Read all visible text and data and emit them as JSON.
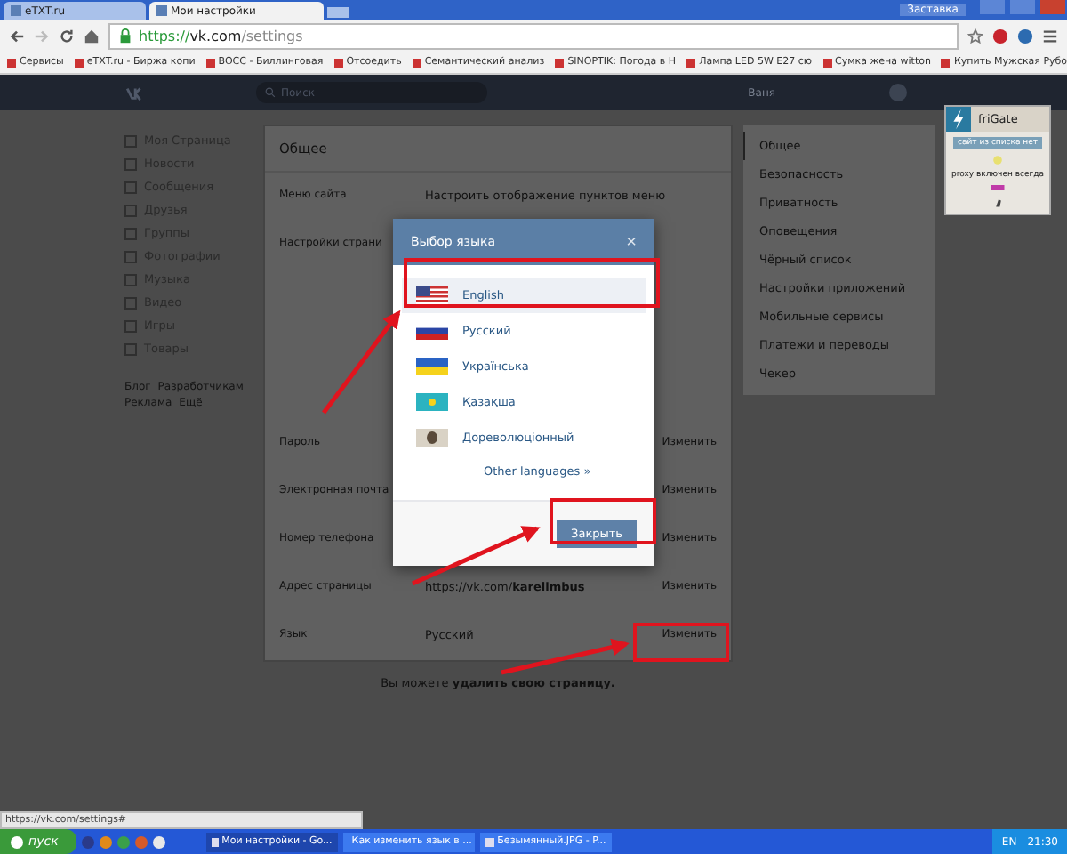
{
  "browser": {
    "tabs": [
      {
        "title": "eTXT.ru",
        "selected": false
      },
      {
        "title": "Мои настройки",
        "selected": true
      }
    ],
    "profile_button": "Заставка",
    "url": {
      "scheme": "https://",
      "host": "vk.com",
      "path": "/settings"
    },
    "bookmarks": [
      {
        "label": "Сервисы"
      },
      {
        "label": "eTXT.ru - Биржа копи"
      },
      {
        "label": "BOCC - Биллинговая"
      },
      {
        "label": "Отсоедить"
      },
      {
        "label": "Семантический анализ"
      },
      {
        "label": "SINOPTIK: Погода в Н"
      },
      {
        "label": "Лампа LED 5W E27 сю"
      },
      {
        "label": "Сумка жена witton"
      },
      {
        "label": "Купить Мужская Рубо"
      }
    ],
    "status_url": "https://vk.com/settings#"
  },
  "header": {
    "search_placeholder": "Поиск",
    "user_name": "Ваня"
  },
  "left_menu": {
    "items": [
      "Моя Страница",
      "Новости",
      "Сообщения",
      "Друзья",
      "Группы",
      "Фотографии",
      "Музыка",
      "Видео",
      "Игры",
      "Товары"
    ],
    "footer": [
      "Блог",
      "Разработчикам",
      "Реклама",
      "Ещё"
    ]
  },
  "settings": {
    "title": "Общее",
    "rows": [
      {
        "label": "Меню сайта",
        "value": "Настроить отображение пунктов меню"
      },
      {
        "label": "Настройки страни"
      },
      {
        "label": "Пароль",
        "action": "Изменить"
      },
      {
        "label": "Электронная почта",
        "action": "Изменить"
      },
      {
        "label": "Номер телефона",
        "action": "Изменить"
      },
      {
        "label": "Адрес страницы",
        "value": "https://vk.com/**karelimbus**",
        "action": "Изменить"
      },
      {
        "label": "Язык",
        "value": "Русский",
        "action": "Изменить"
      }
    ],
    "footer": "Вы можете **удалить свою страницу.**"
  },
  "right_menu": [
    {
      "label": "Общее",
      "selected": true
    },
    {
      "label": "Безопасность",
      "selected": false
    },
    {
      "label": "Приватность",
      "selected": false
    },
    {
      "label": "Оповещения",
      "selected": false
    },
    {
      "label": "Чёрный список",
      "selected": false
    },
    {
      "label": "Настройки приложений",
      "selected": false
    },
    {
      "label": "Мобильные сервисы",
      "selected": false
    },
    {
      "label": "Платежи и переводы",
      "selected": false
    },
    {
      "label": "Чекер",
      "selected": false
    }
  ],
  "extension_popup": {
    "title": "friGate",
    "status": "сайт из списка нет",
    "note": "proxy включен всегда"
  },
  "dialog": {
    "title": "Выбор языка",
    "close": "×",
    "languages": [
      {
        "name": "English",
        "kind": "us",
        "selected": true
      },
      {
        "name": "Русский",
        "kind": "ru",
        "selected": false
      },
      {
        "name": "Українська",
        "kind": "ua",
        "selected": false
      },
      {
        "name": "Қазақша",
        "kind": "kz",
        "selected": false
      },
      {
        "name": "Дореволюціонный",
        "kind": "old",
        "selected": false
      }
    ],
    "more": "Other languages »",
    "button": "Закрыть"
  },
  "taskbar": {
    "start": "пуск",
    "tasks": [
      {
        "title": "Мои настройки - Go...",
        "selected": true
      },
      {
        "title": "Как изменить язык в ...",
        "selected": false
      },
      {
        "title": "Безымянный.JPG - P...",
        "selected": false
      }
    ],
    "language": "EN",
    "clock": "21:30"
  }
}
